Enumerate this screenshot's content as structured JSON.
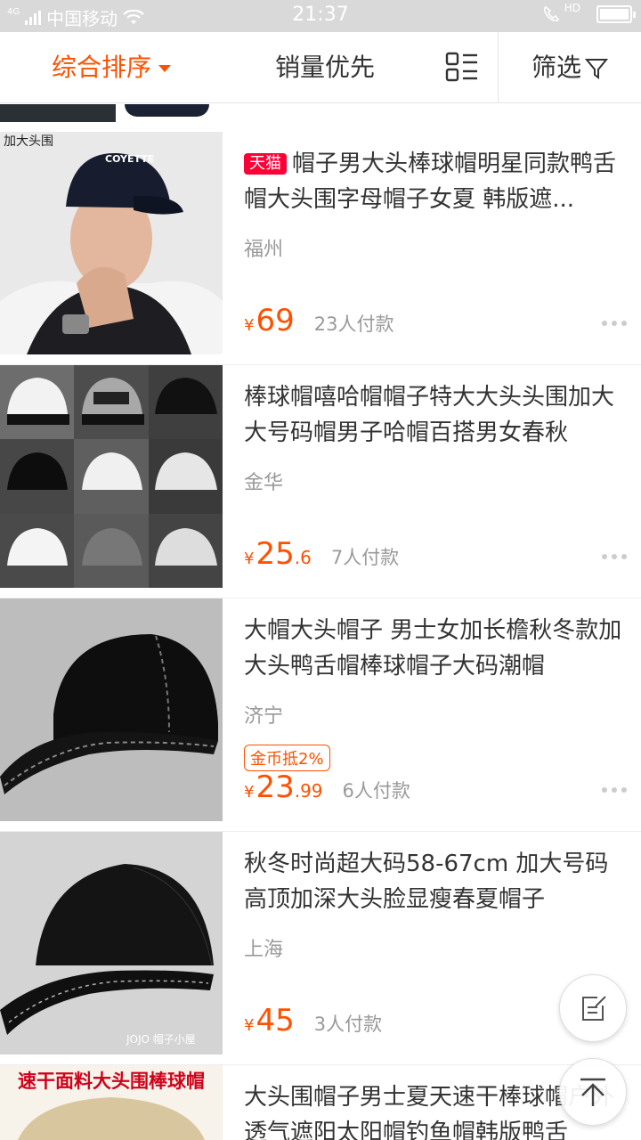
{
  "status_bar": {
    "carrier": "中国移动",
    "network": "4G",
    "time": "21:37",
    "call_tag": "HD",
    "battery_level": 0.9
  },
  "sort_bar": {
    "comprehensive_label": "综合排序",
    "sales_label": "销量优先",
    "filter_label": "筛选",
    "layout_icon": "list-grid-icon",
    "filter_icon": "funnel-icon",
    "accent_color": "#ff5000"
  },
  "items": [
    {
      "badge": "天猫",
      "title": "帽子男大头棒球帽明星同款鸭舌帽大头围字母帽子女夏 韩版遮...",
      "location": "福州",
      "price_int": "69",
      "price_dec": "",
      "paid": "23人付款",
      "image_caption": "加大头围",
      "image_logo": "COYETTE"
    },
    {
      "badge": "",
      "title": "棒球帽嘻哈帽帽子特大大头头围加大大号码帽男子哈帽百搭男女春秋",
      "location": "金华",
      "price_int": "25",
      "price_dec": ".6",
      "paid": "7人付款"
    },
    {
      "badge": "",
      "title": "大帽大头帽子 男士女加长檐秋冬款加大头鸭舌帽棒球帽子大码潮帽",
      "location": "济宁",
      "coupon": "金币抵2%",
      "price_int": "23",
      "price_dec": ".99",
      "paid": "6人付款"
    },
    {
      "badge": "",
      "title": "秋冬时尚超大码58-67cm 加大号码高顶加深大头脸显瘦春夏帽子",
      "location": "上海",
      "price_int": "45",
      "price_dec": "",
      "paid": "3人付款",
      "image_caption": "JOJO 帽子小屋"
    },
    {
      "badge": "",
      "title": "大头围帽子男士夏天速干棒球帽户外透气遮阳太阳帽钓鱼帽韩版鸭舌",
      "image_caption": "速干面料大头围棒球帽"
    }
  ],
  "price_symbol": "¥"
}
